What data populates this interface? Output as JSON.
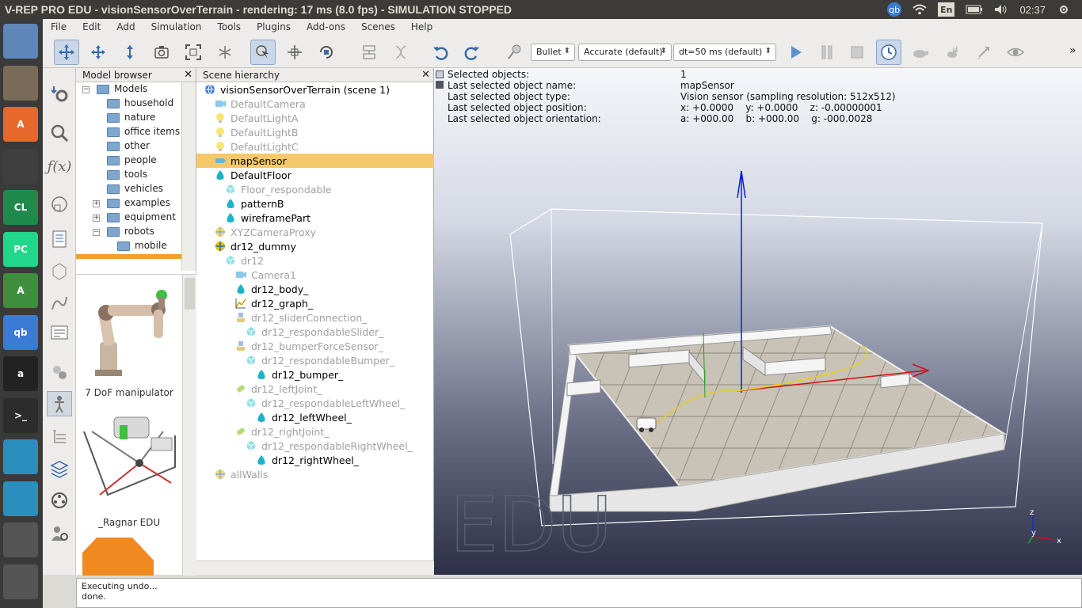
{
  "window_title": "V-REP PRO EDU - visionSensorOverTerrain - rendering: 17 ms (8.0 fps) - SIMULATION STOPPED",
  "indicators": {
    "keyboard": "En",
    "clock": "02:37",
    "qb": "qb"
  },
  "launcher": [
    {
      "name": "ubuntu-dash-icon",
      "label": "",
      "color": "#e95420"
    },
    {
      "name": "files-icon",
      "label": "",
      "color": "#7a6a58"
    },
    {
      "name": "software-center-icon",
      "label": "A",
      "color": "#e8672a"
    },
    {
      "name": "chrome-icon",
      "label": "",
      "color": "#3f3f3f"
    },
    {
      "name": "clion-icon",
      "label": "CL",
      "color": "#1f8a4c"
    },
    {
      "name": "pycharm-icon",
      "label": "PC",
      "color": "#21d789"
    },
    {
      "name": "android-studio-icon",
      "label": "A",
      "color": "#3e8e3e"
    },
    {
      "name": "qbittorrent-icon",
      "label": "qb",
      "color": "#3a7bd5"
    },
    {
      "name": "amazon-icon",
      "label": "a",
      "color": "#222222"
    },
    {
      "name": "terminal-icon",
      "label": ">_",
      "color": "#2c2c2c"
    },
    {
      "name": "vrep-icon-1",
      "label": "",
      "color": "#2a8fbf"
    },
    {
      "name": "vrep-icon-2",
      "label": "",
      "color": "#2a8fbf"
    },
    {
      "name": "workspace-switcher-icon",
      "label": "",
      "color": "#555555"
    },
    {
      "name": "trash-icon",
      "label": "",
      "color": "#555555"
    }
  ],
  "menu": [
    "File",
    "Edit",
    "Add",
    "Simulation",
    "Tools",
    "Plugins",
    "Add-ons",
    "Scenes",
    "Help"
  ],
  "toolbar": {
    "engine": "Bullet",
    "accuracy": "Accurate (default)",
    "dt": "dt=50 ms (default)",
    "more": "»"
  },
  "model_browser": {
    "title": "Model browser",
    "items": [
      {
        "label": "Models",
        "level": 0,
        "expander": "−"
      },
      {
        "label": "household",
        "level": 1,
        "expander": ""
      },
      {
        "label": "nature",
        "level": 1,
        "expander": ""
      },
      {
        "label": "office items",
        "level": 1,
        "expander": ""
      },
      {
        "label": "other",
        "level": 1,
        "expander": ""
      },
      {
        "label": "people",
        "level": 1,
        "expander": ""
      },
      {
        "label": "tools",
        "level": 1,
        "expander": ""
      },
      {
        "label": "vehicles",
        "level": 1,
        "expander": ""
      },
      {
        "label": "examples",
        "level": 1,
        "expander": "+"
      },
      {
        "label": "equipment",
        "level": 1,
        "expander": "+"
      },
      {
        "label": "robots",
        "level": 1,
        "expander": "−"
      },
      {
        "label": "mobile",
        "level": 2,
        "expander": ""
      }
    ],
    "thumbnails": [
      "7 DoF manipulator",
      "_Ragnar EDU"
    ]
  },
  "scene_hierarchy": {
    "title": "Scene hierarchy",
    "rows": [
      {
        "label": "visionSensorOverTerrain (scene 1)",
        "level": 0,
        "dim": false,
        "icon": "globe-icon",
        "color": "#3a7bd5"
      },
      {
        "label": "DefaultCamera",
        "level": 1,
        "dim": true,
        "icon": "camera-icon",
        "color": "#2a9fd8"
      },
      {
        "label": "DefaultLightA",
        "level": 1,
        "dim": true,
        "icon": "light-icon",
        "color": "#f1d200"
      },
      {
        "label": "DefaultLightB",
        "level": 1,
        "dim": true,
        "icon": "light-icon",
        "color": "#f1d200"
      },
      {
        "label": "DefaultLightC",
        "level": 1,
        "dim": true,
        "icon": "light-icon",
        "color": "#f1d200"
      },
      {
        "label": "mapSensor",
        "level": 1,
        "dim": false,
        "icon": "vision-sensor-icon",
        "color": "#5fb8d8",
        "selected": true
      },
      {
        "label": "DefaultFloor",
        "level": 1,
        "dim": false,
        "icon": "shape-icon",
        "color": "#1ab3c8"
      },
      {
        "label": "Floor_respondable",
        "level": 2,
        "dim": true,
        "icon": "cube-icon",
        "color": "#3ec6d0"
      },
      {
        "label": "patternB",
        "level": 2,
        "dim": false,
        "icon": "shape-icon",
        "color": "#1ab3c8"
      },
      {
        "label": "wireframePart",
        "level": 2,
        "dim": false,
        "icon": "shape-icon",
        "color": "#1ab3c8"
      },
      {
        "label": "XYZCameraProxy",
        "level": 1,
        "dim": true,
        "icon": "dummy-icon",
        "color": "#e0c000"
      },
      {
        "label": "dr12_dummy",
        "level": 1,
        "dim": false,
        "icon": "dummy-icon",
        "color": "#e0c000"
      },
      {
        "label": "dr12",
        "level": 2,
        "dim": true,
        "icon": "cube-icon",
        "color": "#3ec6d0"
      },
      {
        "label": "Camera1",
        "level": 3,
        "dim": true,
        "icon": "camera-icon",
        "color": "#2a9fd8"
      },
      {
        "label": "dr12_body_",
        "level": 3,
        "dim": false,
        "icon": "shape-icon",
        "color": "#1ab3c8"
      },
      {
        "label": "dr12_graph_",
        "level": 3,
        "dim": false,
        "icon": "graph-icon",
        "color": "#c8a000"
      },
      {
        "label": "dr12_sliderConnection_",
        "level": 3,
        "dim": true,
        "icon": "force-sensor-icon",
        "color": "#d0a020"
      },
      {
        "label": "dr12_respondableSlider_",
        "level": 4,
        "dim": true,
        "icon": "cube-icon",
        "color": "#3ec6d0"
      },
      {
        "label": "dr12_bumperForceSensor_",
        "level": 3,
        "dim": true,
        "icon": "force-sensor-icon",
        "color": "#d0a020"
      },
      {
        "label": "dr12_respondableBumper_",
        "level": 4,
        "dim": true,
        "icon": "cube-icon",
        "color": "#3ec6d0"
      },
      {
        "label": "dr12_bumper_",
        "level": 5,
        "dim": false,
        "icon": "shape-icon",
        "color": "#1ab3c8"
      },
      {
        "label": "dr12_leftJoint_",
        "level": 3,
        "dim": true,
        "icon": "joint-icon",
        "color": "#7ac000"
      },
      {
        "label": "dr12_respondableLeftWheel_",
        "level": 4,
        "dim": true,
        "icon": "cube-icon",
        "color": "#3ec6d0"
      },
      {
        "label": "dr12_leftWheel_",
        "level": 5,
        "dim": false,
        "icon": "shape-icon",
        "color": "#1ab3c8"
      },
      {
        "label": "dr12_rightJoint_",
        "level": 3,
        "dim": true,
        "icon": "joint-icon",
        "color": "#7ac000"
      },
      {
        "label": "dr12_respondableRightWheel_",
        "level": 4,
        "dim": true,
        "icon": "cube-icon",
        "color": "#3ec6d0"
      },
      {
        "label": "dr12_rightWheel_",
        "level": 5,
        "dim": false,
        "icon": "shape-icon",
        "color": "#1ab3c8"
      },
      {
        "label": "allWalls",
        "level": 1,
        "dim": true,
        "icon": "dummy-icon",
        "color": "#e0c000"
      }
    ]
  },
  "info": {
    "labels": [
      "Selected objects:",
      "Last selected object name:",
      "Last selected object type:",
      "Last selected object position:",
      "Last selected object orientation:"
    ],
    "values": [
      "1",
      "mapSensor",
      "Vision sensor (sampling resolution: 512x512)",
      "x: +0.0000    y: +0.0000    z: -0.00000001",
      "a: +000.00    b: +000.00    g: -000.0028"
    ]
  },
  "viewport": {
    "watermark": "EDU",
    "axis_z": "z",
    "axis_y": "y",
    "axis_x": "x"
  },
  "console": [
    "Executing undo...",
    "done."
  ]
}
